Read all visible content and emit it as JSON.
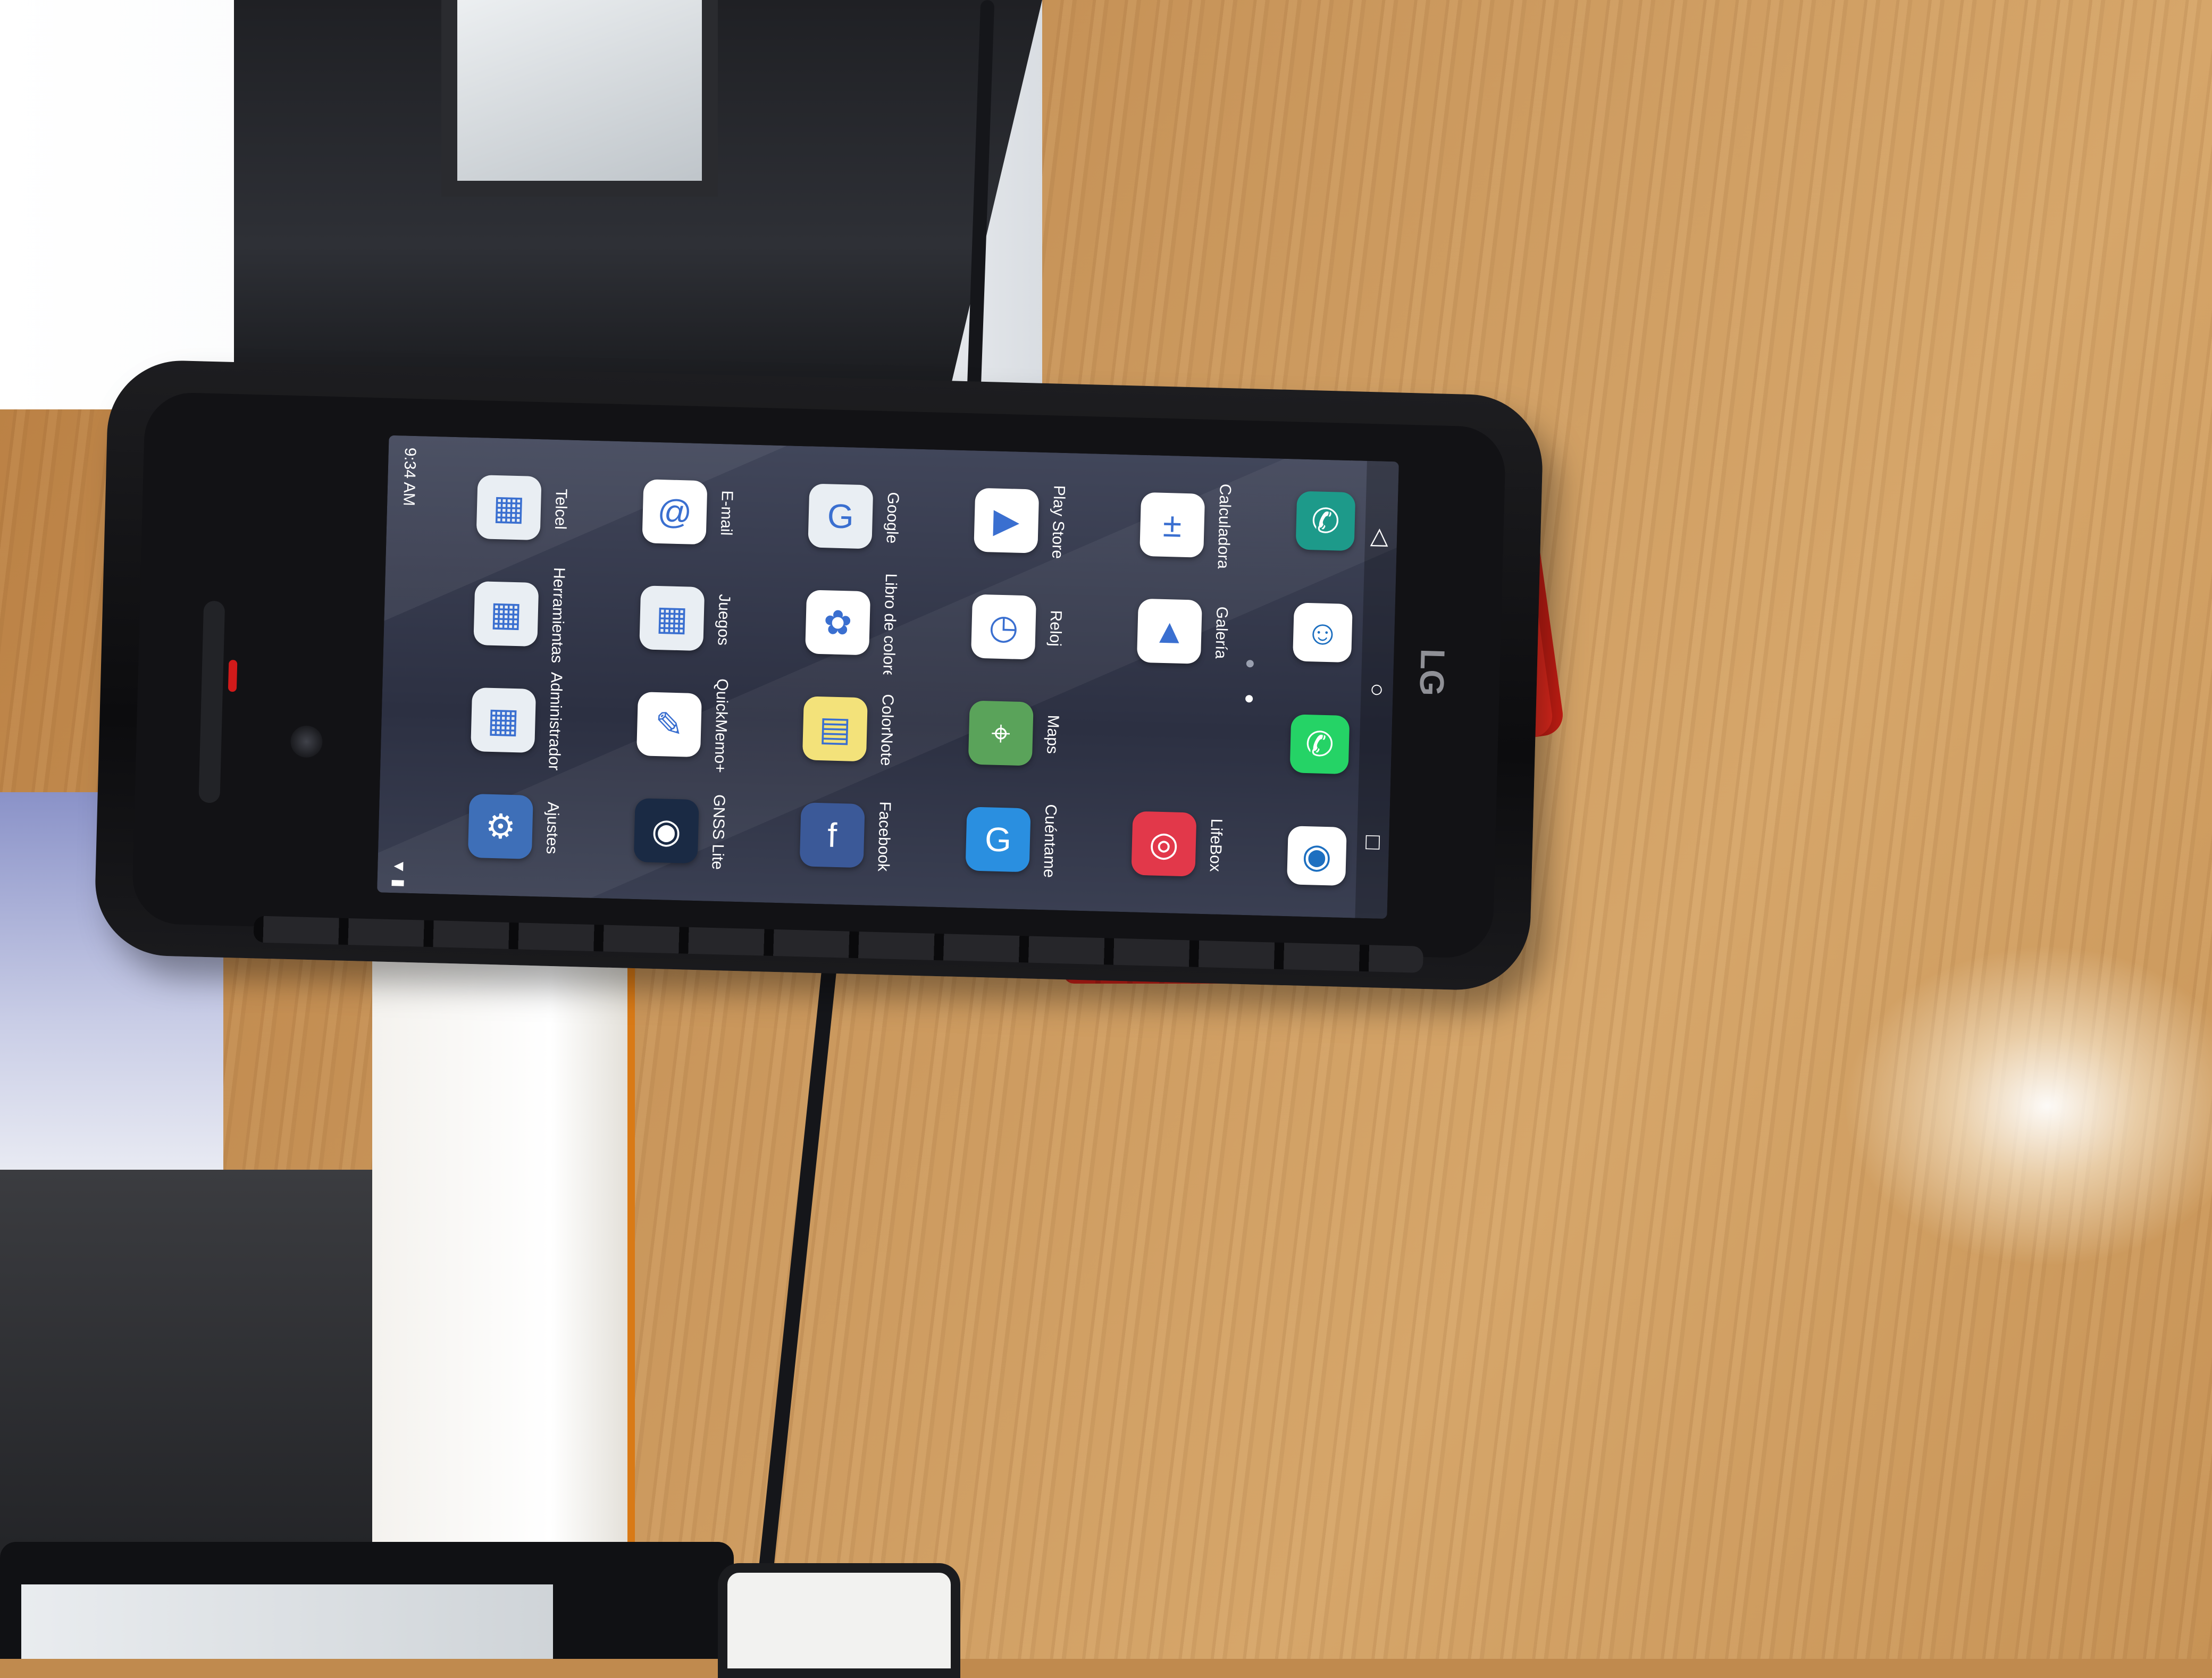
{
  "scene": {
    "status_bar": {
      "time": "9:34 AM",
      "icons": "▼ ▮"
    },
    "apps": [
      {
        "label": "Telcel",
        "icon": "folder-icon",
        "glyph": "▦",
        "color": "#e9eef3"
      },
      {
        "label": "Herramientas",
        "icon": "folder-icon",
        "glyph": "▦",
        "color": "#e9eef3"
      },
      {
        "label": "Administrador",
        "icon": "folder-icon",
        "glyph": "▦",
        "color": "#e9eef3"
      },
      {
        "label": "Ajustes",
        "icon": "gear-icon",
        "glyph": "⚙",
        "color": "#3e6fb8"
      },
      {
        "label": "E-mail",
        "icon": "email-icon",
        "glyph": "@",
        "color": "#ffffff"
      },
      {
        "label": "Juegos",
        "icon": "folder-icon",
        "glyph": "▦",
        "color": "#e9eef3"
      },
      {
        "label": "QuickMemo+",
        "icon": "pen-icon",
        "glyph": "✎",
        "color": "#ffffff"
      },
      {
        "label": "GNSS Lite",
        "icon": "lens-icon",
        "glyph": "◉",
        "color": "#1a2a44"
      },
      {
        "label": "Google",
        "icon": "folder-icon",
        "glyph": "G",
        "color": "#e9eef3"
      },
      {
        "label": "Libro de colorear para mí",
        "icon": "mandala-icon",
        "glyph": "✿",
        "color": "#ffffff"
      },
      {
        "label": "ColorNote",
        "icon": "note-icon",
        "glyph": "▤",
        "color": "#f3e27a"
      },
      {
        "label": "Facebook",
        "icon": "facebook-icon",
        "glyph": "f",
        "color": "#3b5998"
      },
      {
        "label": "Play Store",
        "icon": "play-store-icon",
        "glyph": "▶",
        "color": "#ffffff"
      },
      {
        "label": "Reloj",
        "icon": "clock-icon",
        "glyph": "◷",
        "color": "#ffffff"
      },
      {
        "label": "Maps",
        "icon": "map-pin-icon",
        "glyph": "⌖",
        "color": "#5aa35a"
      },
      {
        "label": "Cuéntame",
        "icon": "chat-icon",
        "glyph": "G",
        "color": "#2a8fe0"
      },
      {
        "label": "Calculadora",
        "icon": "calculator-icon",
        "glyph": "±",
        "color": "#ffffff"
      },
      {
        "label": "Galería",
        "icon": "gallery-icon",
        "glyph": "▲",
        "color": "#ffffff"
      },
      {
        "label": "",
        "icon": "spacer",
        "glyph": "",
        "color": "transparent"
      },
      {
        "label": "LifeBox",
        "icon": "target-icon",
        "glyph": "◎",
        "color": "#e2384a"
      }
    ],
    "dock": [
      {
        "icon": "phone-icon",
        "glyph": "✆",
        "color": "#1d9a8a"
      },
      {
        "icon": "contacts-icon",
        "glyph": "☺",
        "color": "#ffffff"
      },
      {
        "icon": "whatsapp-icon",
        "glyph": "✆",
        "color": "#25d366"
      },
      {
        "icon": "camera-icon",
        "glyph": "◉",
        "color": "#ffffff"
      }
    ],
    "navbar": {
      "back": "◁",
      "home": "○",
      "recents": "□"
    },
    "brand": "LG"
  }
}
